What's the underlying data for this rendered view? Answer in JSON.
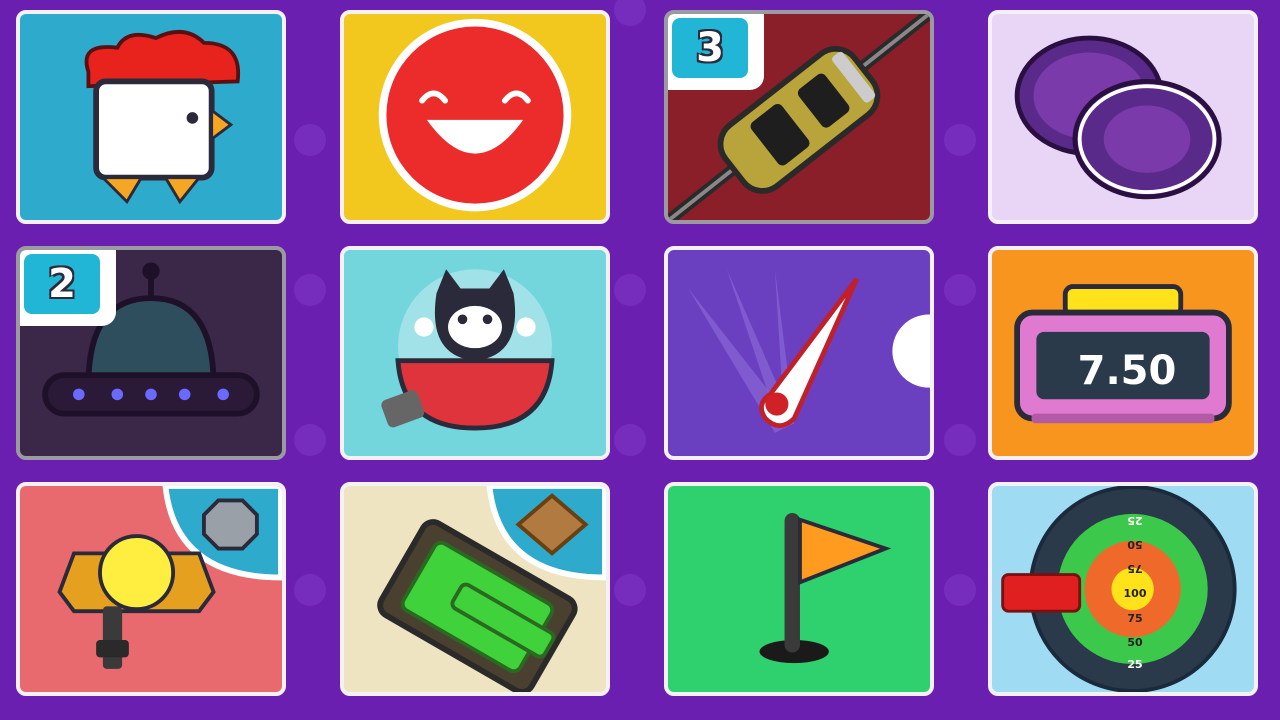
{
  "theme": {
    "background": "#6a1fb0",
    "tile_border": "#f3f0f6"
  },
  "tiles": [
    {
      "id": "chicken",
      "bg": "#2eaacc",
      "icon": "chicken-icon"
    },
    {
      "id": "smiley",
      "bg": "#f2c81e",
      "icon": "smiley-face-icon"
    },
    {
      "id": "race-car",
      "bg": "#8a1f2a",
      "icon": "race-car-icon",
      "badge": "3",
      "locked": true
    },
    {
      "id": "air-hockey",
      "bg": "#e9d6f7",
      "icon": "air-hockey-pucks-icon"
    },
    {
      "id": "ufo",
      "bg": "#3b2748",
      "icon": "ufo-icon",
      "badge": "2",
      "locked": true
    },
    {
      "id": "cat-bowl",
      "bg": "#72d6dc",
      "icon": "cat-in-bowl-icon"
    },
    {
      "id": "pinball",
      "bg": "#6a3fc0",
      "icon": "pinball-flipper-icon"
    },
    {
      "id": "timer",
      "bg": "#f7951e",
      "icon": "stopwatch-icon",
      "display": "7.50"
    },
    {
      "id": "catcher",
      "bg": "#e86a6e",
      "icon": "claw-catcher-icon"
    },
    {
      "id": "tank",
      "bg": "#efe4c2",
      "icon": "tank-icon"
    },
    {
      "id": "golf",
      "bg": "#2fd16e",
      "icon": "golf-flag-icon"
    },
    {
      "id": "darts",
      "bg": "#9fdcf4",
      "icon": "dartboard-icon",
      "rings": [
        "25",
        "50",
        "75",
        "100",
        "75",
        "50",
        "25"
      ]
    }
  ]
}
